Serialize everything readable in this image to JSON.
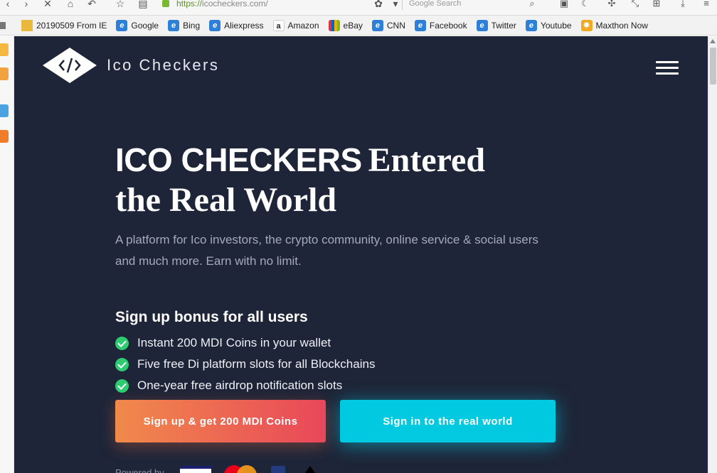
{
  "browser": {
    "url_prefix": "https://",
    "url_domain": "icocheckers.com/",
    "search_placeholder": "Google Search",
    "bookmarks": [
      {
        "label": "20190509 From IE",
        "icon": "folder-icon"
      },
      {
        "label": "Google",
        "icon": "ie-icon"
      },
      {
        "label": "Bing",
        "icon": "ie-icon"
      },
      {
        "label": "Aliexpress",
        "icon": "ie-icon"
      },
      {
        "label": "Amazon",
        "icon": "amazon-icon"
      },
      {
        "label": "eBay",
        "icon": "ebay-icon"
      },
      {
        "label": "CNN",
        "icon": "ie-icon"
      },
      {
        "label": "Facebook",
        "icon": "ie-icon"
      },
      {
        "label": "Twitter",
        "icon": "ie-icon"
      },
      {
        "label": "Youtube",
        "icon": "ie-icon"
      },
      {
        "label": "Maxthon Now",
        "icon": "maxthon-icon"
      }
    ]
  },
  "site": {
    "logo_text": "Ico Checkers",
    "hero": {
      "title_bold": "ICO CHECKERS",
      "title_rest_1": "Entered",
      "title_rest_2": "the Real World",
      "subtitle": "A platform for Ico investors, the crypto community, online service & social users and much more. Earn with no limit."
    },
    "bonus": {
      "title": "Sign up bonus for all users",
      "items": [
        "Instant 200 MDI Coins in your wallet",
        "Five free Di platform slots for all Blockchains",
        "One-year free airdrop notification slots"
      ]
    },
    "buttons": {
      "signup": "Sign up & get 200 MDI Coins",
      "signin": "Sign in to the real world"
    },
    "powered_by": "Powered by"
  },
  "colors": {
    "site_bg": "#1e2538",
    "signin_accent": "#00c9e0",
    "signup_gradient_start": "#f08a4b",
    "signup_gradient_end": "#e9475a",
    "check_green": "#2ecc71"
  }
}
